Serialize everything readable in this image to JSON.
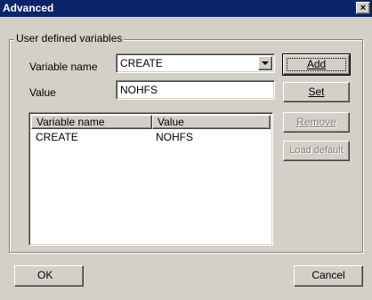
{
  "window": {
    "title": "Advanced",
    "close_glyph": "×"
  },
  "group": {
    "label": "User defined variables"
  },
  "fields": {
    "name_label": "Variable name",
    "name_value": "CREATE",
    "value_label": "Value",
    "value_value": "NOHFS"
  },
  "buttons": {
    "add": "Add",
    "set": "Set",
    "remove": "Remove",
    "load_default": "Load default",
    "ok": "OK",
    "cancel": "Cancel"
  },
  "list": {
    "columns": [
      "Variable name",
      "Value"
    ],
    "rows": [
      {
        "name": "CREATE",
        "value": "NOHFS"
      }
    ]
  }
}
